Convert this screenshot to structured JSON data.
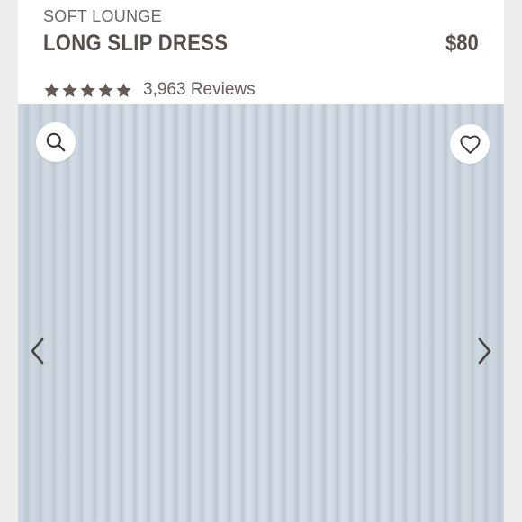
{
  "product": {
    "brand": "SOFT LOUNGE",
    "name": "LONG SLIP DRESS",
    "price": "$80",
    "rating_stars": 5,
    "reviews_text": "3,963 Reviews"
  },
  "gallery": {
    "zoom_icon": "search-icon",
    "favorite_icon": "heart-icon",
    "prev_icon": "chevron-left-icon",
    "next_icon": "chevron-right-icon"
  },
  "colors": {
    "text_dark": "#574f49",
    "text_muted": "#6d6660",
    "star": "#655b52",
    "fabric": "#c5d0da"
  }
}
